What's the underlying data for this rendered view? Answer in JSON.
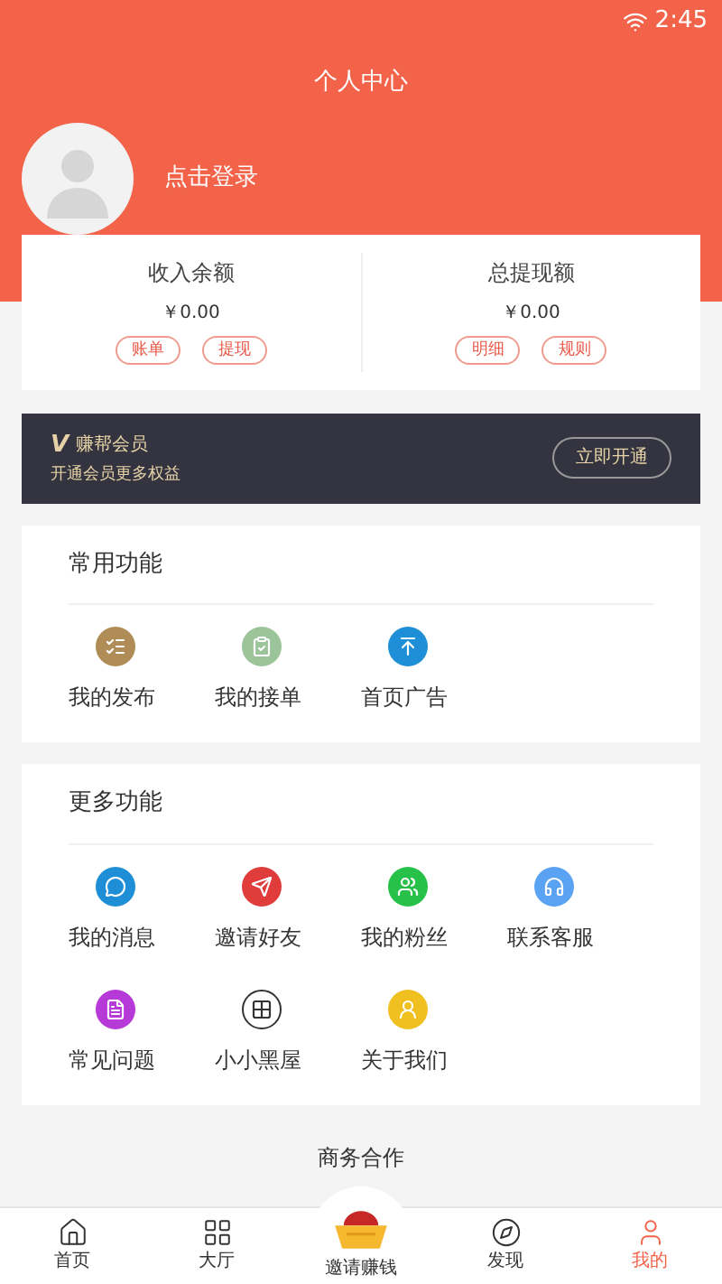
{
  "status_bar": {
    "time": "2:45"
  },
  "header": {
    "title": "个人中心",
    "login": "点击登录"
  },
  "balances": [
    {
      "label": "收入余额",
      "amount": "￥0.00",
      "buttons": [
        "账单",
        "提现"
      ]
    },
    {
      "label": "总提现额",
      "amount": "￥0.00",
      "buttons": [
        "明细",
        "规则"
      ]
    }
  ],
  "vip": {
    "badge": "V",
    "title": "赚帮会员",
    "subtitle": "开通会员更多权益",
    "button": "立即开通"
  },
  "common": {
    "title": "常用功能",
    "items": [
      {
        "label": "我的发布",
        "color": "#b08d57"
      },
      {
        "label": "我的接单",
        "color": "#9cc49a"
      },
      {
        "label": "首页广告",
        "color": "#1e8fd6"
      }
    ]
  },
  "more": {
    "title": "更多功能",
    "items": [
      {
        "label": "我的消息",
        "color": "#1e8fd6",
        "kind": "filled"
      },
      {
        "label": "邀请好友",
        "color": "#e03c3c",
        "kind": "filled"
      },
      {
        "label": "我的粉丝",
        "color": "#27c14a",
        "kind": "filled"
      },
      {
        "label": "联系客服",
        "color": "#5aa2f2",
        "kind": "filled"
      },
      {
        "label": "常见问题",
        "color": "#b63ad8",
        "kind": "filled"
      },
      {
        "label": "小小黑屋",
        "color": "#333333",
        "kind": "outline"
      },
      {
        "label": "关于我们",
        "color": "#f0c020",
        "kind": "filled"
      }
    ]
  },
  "business": "商务合作",
  "tabs": [
    {
      "label": "首页",
      "selected": false
    },
    {
      "label": "大厅",
      "selected": false
    },
    {
      "label": "邀请赚钱",
      "selected": false,
      "kind": "center"
    },
    {
      "label": "发现",
      "selected": false
    },
    {
      "label": "我的",
      "selected": true
    }
  ]
}
